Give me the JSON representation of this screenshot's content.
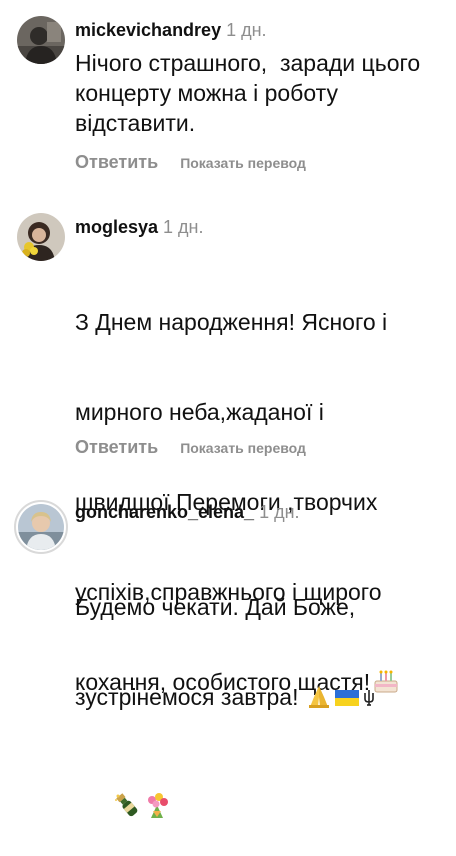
{
  "comments": [
    {
      "username": "mickevichandrey",
      "time": "1 дн.",
      "text": "Нічого страшного,  заради цього концерту можна і роботу відставити.",
      "reply_label": "Ответить",
      "translate_label": "Показать перевод"
    },
    {
      "username": "moglesya",
      "time": "1 дн.",
      "text_lines": [
        "З Днем народження! Ясного і",
        "мирного неба,жаданої і",
        "швидшої Перемоги ,творчих",
        "успіхів,справжнього і щирого",
        "кохання, особистого щастя!"
      ],
      "emojis": [
        "birthday-cake-emoji",
        "champagne-emoji",
        "flowers-emoji"
      ],
      "reply_label": "Ответить",
      "translate_label": "Показать перевод"
    },
    {
      "username": "goncharenko_elena_",
      "time": "1 дн.",
      "text_lines": [
        "Будемо чекати. Дай Боже,",
        "зустрінемося завтра!"
      ],
      "emojis": [
        "folded-hands-emoji",
        "ukraine-flag-emoji",
        "tryzub-emoji"
      ]
    }
  ],
  "colors": {
    "text": "#111111",
    "muted": "#8e8e8e",
    "background": "#ffffff"
  }
}
